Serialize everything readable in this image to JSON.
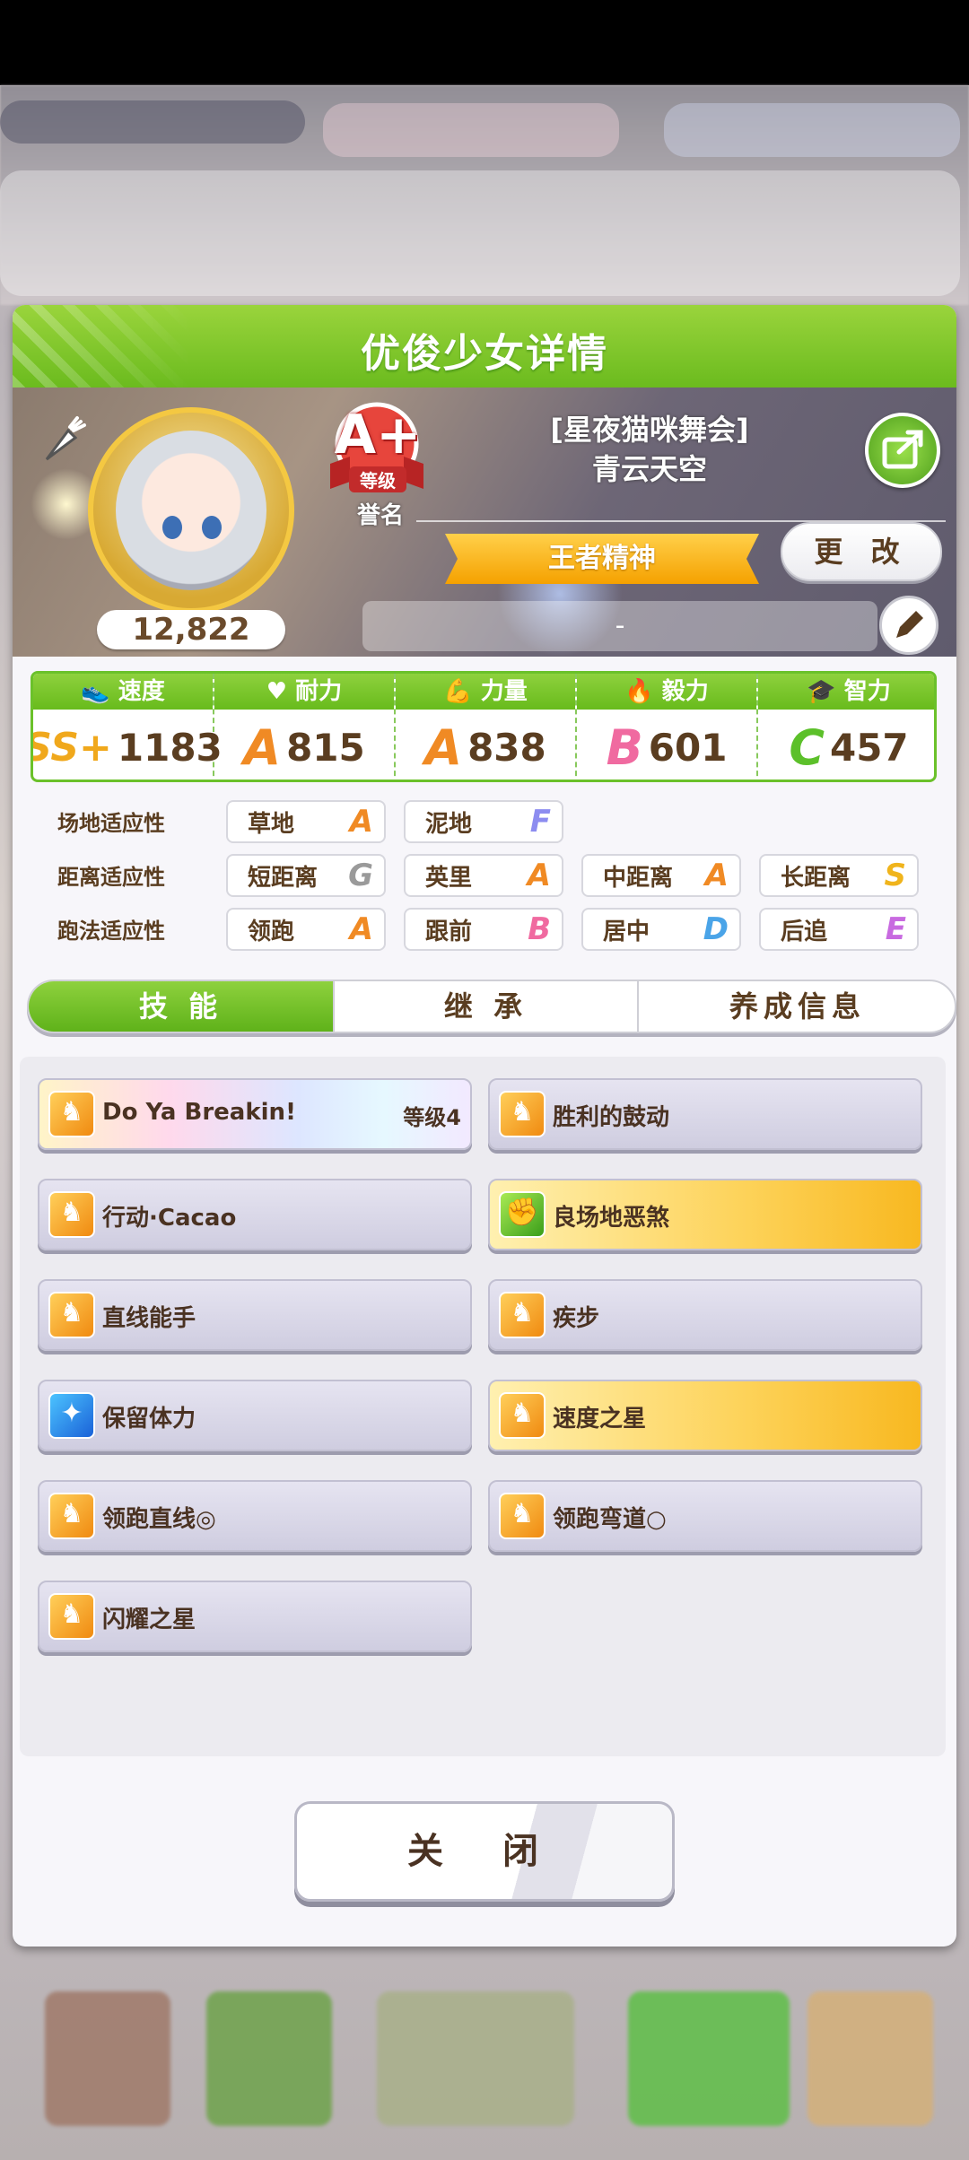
{
  "panel": {
    "title": "优俊少女详情"
  },
  "profile": {
    "fans": "12,822",
    "grade_rank": "A+",
    "grade_label": "等级",
    "fame_label": "誉名",
    "outfit": "[星夜猫咪舞会]",
    "name": "青云天空",
    "title_badge": "王者精神",
    "change_label": "更 改",
    "memo": "-"
  },
  "stats": [
    {
      "label": "速度",
      "rank": "SS+",
      "value": "1183",
      "color": "#f0a81c"
    },
    {
      "label": "耐力",
      "rank": "A",
      "value": "815",
      "color": "#f08a24"
    },
    {
      "label": "力量",
      "rank": "A",
      "value": "838",
      "color": "#f08a24"
    },
    {
      "label": "毅力",
      "rank": "B",
      "value": "601",
      "color": "#f06aa0"
    },
    {
      "label": "智力",
      "rank": "C",
      "value": "457",
      "color": "#5cc02a"
    }
  ],
  "aptitude": {
    "track_label": "场地适应性",
    "distance_label": "距离适应性",
    "style_label": "跑法适应性",
    "track": [
      {
        "name": "草地",
        "grade": "A",
        "color": "#f08a24"
      },
      {
        "name": "泥地",
        "grade": "F",
        "color": "#8c8cf0"
      }
    ],
    "distance": [
      {
        "name": "短距离",
        "grade": "G",
        "color": "#9a9a9a"
      },
      {
        "name": "英里",
        "grade": "A",
        "color": "#f08a24"
      },
      {
        "name": "中距离",
        "grade": "A",
        "color": "#f08a24"
      },
      {
        "name": "长距离",
        "grade": "S",
        "color": "#f0b41c"
      }
    ],
    "style": [
      {
        "name": "领跑",
        "grade": "A",
        "color": "#f08a24"
      },
      {
        "name": "跟前",
        "grade": "B",
        "color": "#f06aa0"
      },
      {
        "name": "居中",
        "grade": "D",
        "color": "#4aa4e8"
      },
      {
        "name": "后追",
        "grade": "E",
        "color": "#c86ae0"
      }
    ]
  },
  "tabs": [
    "技 能",
    "继 承",
    "养成信息"
  ],
  "skills": [
    {
      "name": "Do Ya Breakin!",
      "level": "等级4",
      "icon": "running-horse-icon"
    },
    {
      "name": "胜利的鼓动",
      "icon": "running-horse-icon"
    },
    {
      "name": "行动·Cacao",
      "icon": "running-horse-icon"
    },
    {
      "name": "良场地恶煞",
      "icon": "strength-arm-icon"
    },
    {
      "name": "直线能手",
      "icon": "running-horse-icon"
    },
    {
      "name": "疾步",
      "icon": "running-horse-icon"
    },
    {
      "name": "保留体力",
      "icon": "sparkle-icon"
    },
    {
      "name": "速度之星",
      "icon": "running-horse-icon"
    },
    {
      "name": "领跑直线◎",
      "icon": "running-horse-icon"
    },
    {
      "name": "领跑弯道○",
      "icon": "running-horse-icon"
    },
    {
      "name": "闪耀之星",
      "icon": "running-horse-icon"
    }
  ],
  "close_label": "关 闭"
}
